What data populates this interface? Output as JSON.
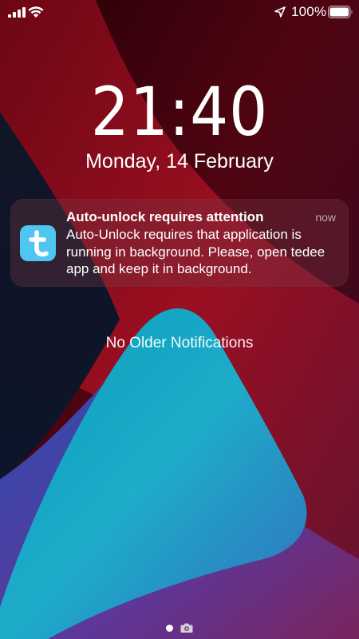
{
  "status_bar": {
    "battery_percent": "100%",
    "icons": [
      "signal-icon",
      "wifi-icon",
      "location-icon",
      "battery-icon"
    ]
  },
  "lock_screen": {
    "time": "21:40",
    "date": "Monday, 14 February"
  },
  "notification": {
    "app_icon": "tedee-app-icon",
    "title": "Auto-unlock requires attention",
    "time": "now",
    "body": "Auto-Unlock requires that application is running in background. Please, open tedee app and keep it in background.",
    "icon_color": "#4fc6f0"
  },
  "footer": {
    "no_older_label": "No Older Notifications",
    "icons": [
      "page-dot",
      "camera-icon"
    ]
  }
}
